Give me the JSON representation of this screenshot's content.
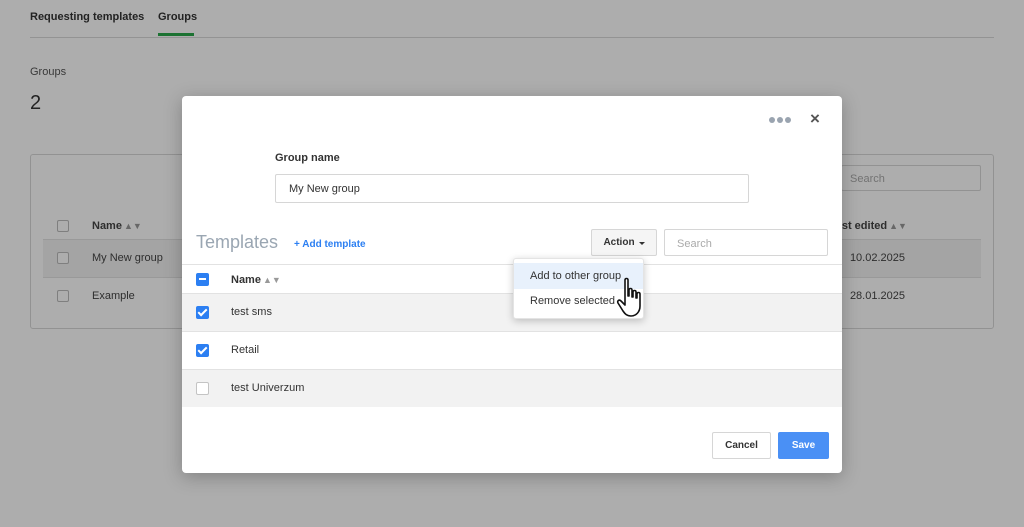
{
  "background": {
    "tabs": [
      "Requesting templates",
      "Groups"
    ],
    "active_tab": "Groups",
    "groups_label": "Groups",
    "groups_count": "2",
    "search_placeholder": "Search",
    "columns": {
      "name": "Name",
      "last_edited": "Last edited"
    },
    "rows": [
      {
        "name": "My New group",
        "date": "10.02.2025"
      },
      {
        "name": "Example",
        "date": "28.01.2025"
      }
    ]
  },
  "modal": {
    "group_name_label": "Group name",
    "group_name_value": "My New group",
    "templates_title": "Templates",
    "add_template_label": "+ Add template",
    "action_label": "Action",
    "search_placeholder": "Search",
    "name_column": "Name",
    "templates": [
      {
        "name": "test sms",
        "checked": true
      },
      {
        "name": "Retail",
        "checked": true
      },
      {
        "name": "test Univerzum",
        "checked": false
      }
    ],
    "select_all_state": "partial",
    "dropdown": [
      "Add to other group",
      "Remove selected"
    ],
    "cancel_label": "Cancel",
    "save_label": "Save"
  },
  "icons": {
    "sort": "▲▼",
    "close": "×"
  },
  "colors": {
    "accent": "#2c7ff2",
    "save": "#4a90f5",
    "tab_active": "#2aa84a"
  }
}
